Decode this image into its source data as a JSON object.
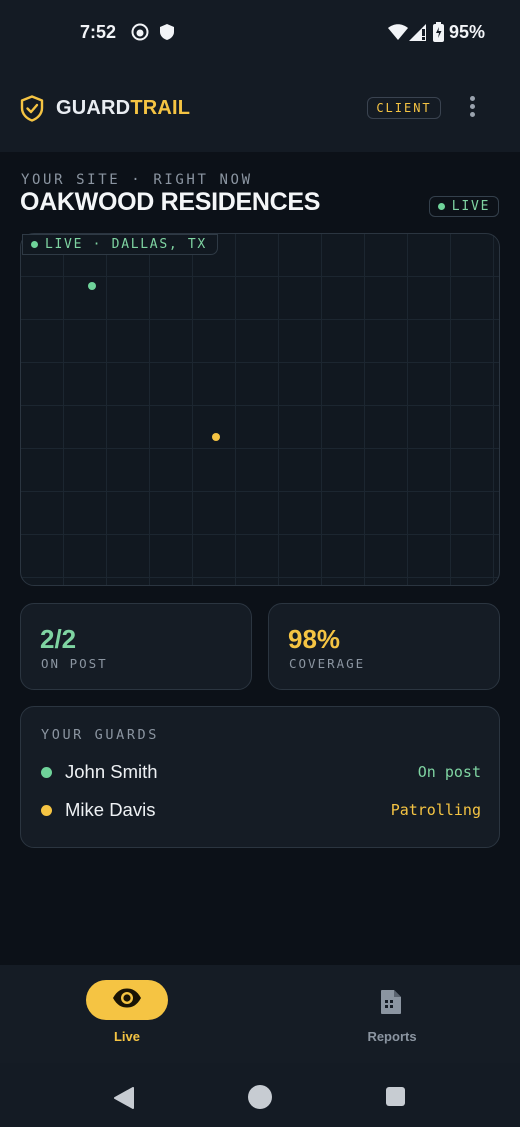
{
  "status_bar": {
    "time": "7:52",
    "icons": [
      "face-icon",
      "shield-icon",
      "wifi-icon",
      "signal-icon",
      "battery-icon"
    ],
    "battery": "95%"
  },
  "app": {
    "brand_part1": "GUARD",
    "brand_part2": "TRAIL",
    "role_badge": "CLIENT",
    "colors": {
      "accent": "#f5c443",
      "live_green": "#6fd39a",
      "background": "#0c1118",
      "card": "#151c25"
    }
  },
  "site": {
    "subtitle": "YOUR SITE · RIGHT NOW",
    "name": "OAKWOOD RESIDENCES",
    "live_badge": "LIVE"
  },
  "map": {
    "tag": "LIVE · DALLAS, TX",
    "markers": [
      {
        "guard": "John Smith",
        "color": "#6fd39a"
      },
      {
        "guard": "Mike Davis",
        "color": "#f5c443"
      }
    ]
  },
  "stats": [
    {
      "value": "2/2",
      "label": "ON POST"
    },
    {
      "value": "98%",
      "label": "COVERAGE"
    }
  ],
  "guards": {
    "title": "YOUR GUARDS",
    "items": [
      {
        "name": "John Smith",
        "status": "On post",
        "color": "#6fd39a"
      },
      {
        "name": "Mike Davis",
        "status": "Patrolling",
        "color": "#f5c443"
      }
    ]
  },
  "bottom_nav": {
    "items": [
      {
        "label": "Live",
        "icon": "eye-icon",
        "active": true
      },
      {
        "label": "Reports",
        "icon": "report-icon",
        "active": false
      }
    ]
  },
  "system_nav": {
    "icons": [
      "back-icon",
      "home-icon",
      "recents-icon"
    ]
  }
}
